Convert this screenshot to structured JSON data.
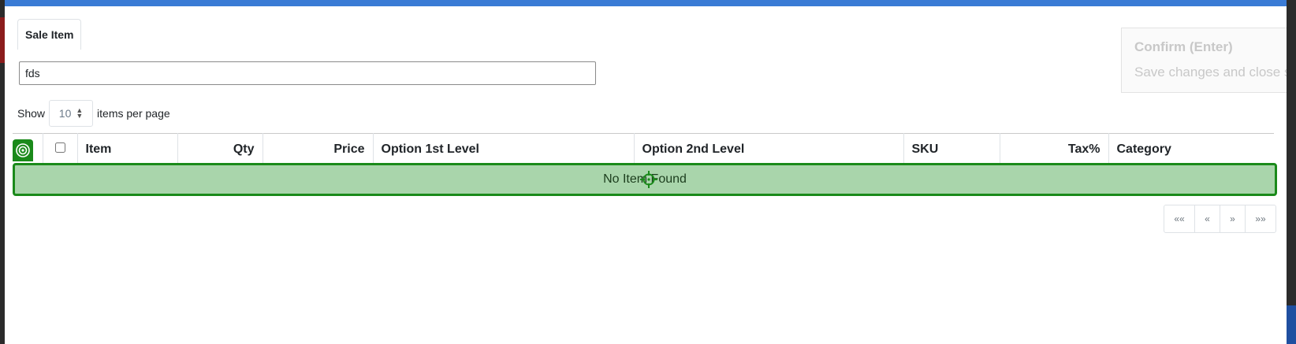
{
  "colors": {
    "modal_topbar": "#3a7bd5",
    "highlight_border": "#1a8a1a",
    "highlight_fill": "#a9d5ab"
  },
  "tabs": [
    {
      "label": "Sale Item",
      "active": true
    }
  ],
  "search": {
    "value": "fds",
    "placeholder": ""
  },
  "pagination_settings": {
    "show_label": "Show",
    "per_page_value": "10",
    "suffix_label": "items per page"
  },
  "confirm": {
    "title": "Confirm (Enter)",
    "description": "Save changes and close s"
  },
  "table": {
    "columns": [
      {
        "label": "Item"
      },
      {
        "label": "Qty"
      },
      {
        "label": "Price"
      },
      {
        "label": "Option 1st Level"
      },
      {
        "label": "Option 2nd Level"
      },
      {
        "label": "SKU"
      },
      {
        "label": "Tax%"
      },
      {
        "label": "Category"
      }
    ],
    "empty_message": "No Item Found"
  },
  "pager": {
    "first": "««",
    "prev": "«",
    "next": "»",
    "last": "»»"
  },
  "icons": {
    "select_all_badge": "target-icon",
    "cursor_marker": "crosshair-icon",
    "per_page_spinner": "chevron-updown-icon"
  }
}
